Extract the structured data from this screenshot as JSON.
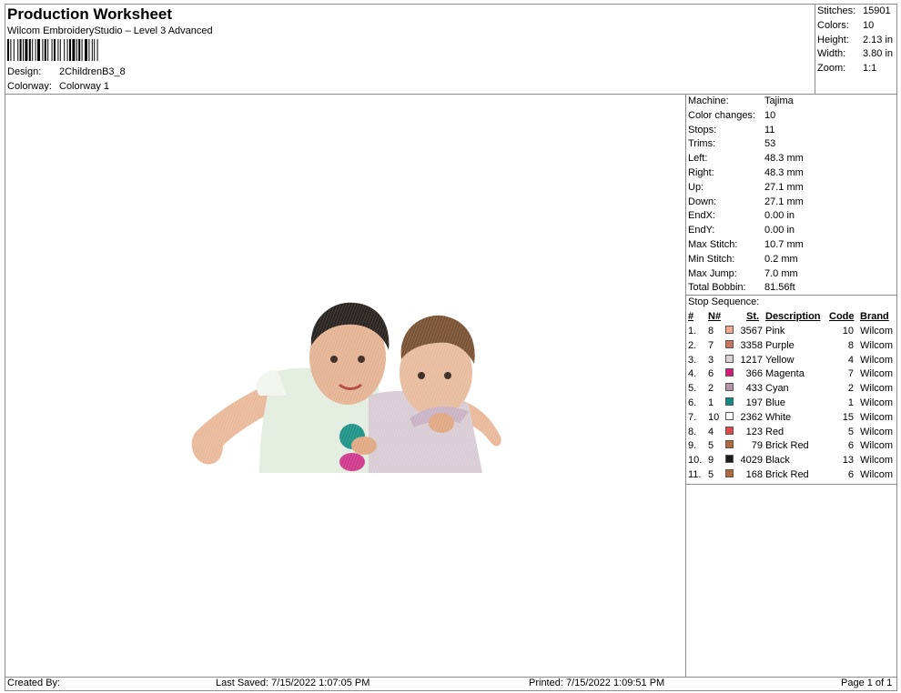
{
  "header": {
    "title": "Production Worksheet",
    "subtitle": "Wilcom EmbroideryStudio – Level 3 Advanced",
    "design_label": "Design:",
    "design_value": "2ChildrenB3_8",
    "colorway_label": "Colorway:",
    "colorway_value": "Colorway 1"
  },
  "summary": [
    {
      "label": "Stitches:",
      "value": "15901"
    },
    {
      "label": "Colors:",
      "value": "10"
    },
    {
      "label": "Height:",
      "value": "2.13 in"
    },
    {
      "label": "Width:",
      "value": "3.80 in"
    },
    {
      "label": "Zoom:",
      "value": "1:1"
    }
  ],
  "machine_stats": [
    {
      "label": "Machine:",
      "value": "Tajima"
    },
    {
      "label": "Color changes:",
      "value": "10"
    },
    {
      "label": "Stops:",
      "value": "11"
    },
    {
      "label": "Trims:",
      "value": "53"
    },
    {
      "label": "Left:",
      "value": "48.3 mm"
    },
    {
      "label": "Right:",
      "value": "48.3 mm"
    },
    {
      "label": "Up:",
      "value": "27.1 mm"
    },
    {
      "label": "Down:",
      "value": "27.1 mm"
    },
    {
      "label": "EndX:",
      "value": "0.00 in"
    },
    {
      "label": "EndY:",
      "value": "0.00 in"
    },
    {
      "label": "Max Stitch:",
      "value": "10.7 mm"
    },
    {
      "label": "Min Stitch:",
      "value": "0.2 mm"
    },
    {
      "label": "Max Jump:",
      "value": "7.0 mm"
    },
    {
      "label": "Total Bobbin:",
      "value": "81.56ft"
    }
  ],
  "stop_sequence": {
    "title": "Stop Sequence:",
    "headers": {
      "num": "#",
      "n": "N#",
      "st": "St.",
      "desc": "Description",
      "code": "Code",
      "brand": "Brand"
    },
    "rows": [
      {
        "num": "1.",
        "n": "8",
        "color": "#f2a98f",
        "st": "3567",
        "desc": "Pink",
        "code": "10",
        "brand": "Wilcom"
      },
      {
        "num": "2.",
        "n": "7",
        "color": "#c9745e",
        "st": "3358",
        "desc": "Purple",
        "code": "8",
        "brand": "Wilcom"
      },
      {
        "num": "3.",
        "n": "3",
        "color": "#dcd2d6",
        "st": "1217",
        "desc": "Yellow",
        "code": "4",
        "brand": "Wilcom"
      },
      {
        "num": "4.",
        "n": "6",
        "color": "#d5187a",
        "st": "366",
        "desc": "Magenta",
        "code": "7",
        "brand": "Wilcom"
      },
      {
        "num": "5.",
        "n": "2",
        "color": "#b994a9",
        "st": "433",
        "desc": "Cyan",
        "code": "2",
        "brand": "Wilcom"
      },
      {
        "num": "6.",
        "n": "1",
        "color": "#0f8c86",
        "st": "197",
        "desc": "Blue",
        "code": "1",
        "brand": "Wilcom"
      },
      {
        "num": "7.",
        "n": "10",
        "color": "#ffffff",
        "st": "2362",
        "desc": "White",
        "code": "15",
        "brand": "Wilcom"
      },
      {
        "num": "8.",
        "n": "4",
        "color": "#e0484c",
        "st": "123",
        "desc": "Red",
        "code": "5",
        "brand": "Wilcom"
      },
      {
        "num": "9.",
        "n": "5",
        "color": "#b26a3c",
        "st": "79",
        "desc": "Brick Red",
        "code": "6",
        "brand": "Wilcom"
      },
      {
        "num": "10.",
        "n": "9",
        "color": "#1c1c1c",
        "st": "4029",
        "desc": "Black",
        "code": "13",
        "brand": "Wilcom"
      },
      {
        "num": "11.",
        "n": "5",
        "color": "#b26a3c",
        "st": "168",
        "desc": "Brick Red",
        "code": "6",
        "brand": "Wilcom"
      }
    ]
  },
  "footer": {
    "created_by": "Created By:",
    "last_saved": "Last Saved: 7/15/2022 1:07:05 PM",
    "printed": "Printed: 7/15/2022 1:09:51 PM",
    "page": "Page 1 of 1"
  },
  "preview": {
    "icon": "embroidery-design-preview"
  }
}
